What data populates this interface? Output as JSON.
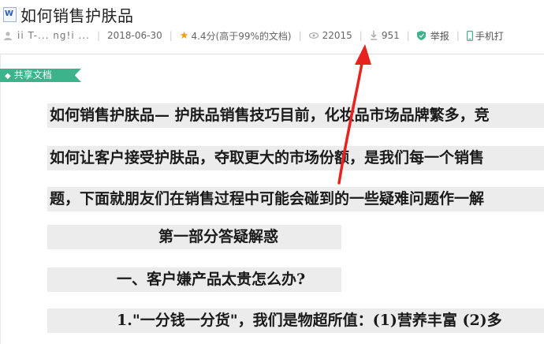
{
  "document": {
    "type_badge": "W",
    "title": "如何销售护肤品"
  },
  "meta": {
    "author": "ii T-... ng!i ...",
    "date": "2018-06-30",
    "rating": "4.4分(高于99%的文档)",
    "views": "22015",
    "downloads": "951",
    "report_label": "举报",
    "mobile_label": "手机打"
  },
  "share_tag": "共享文档",
  "body_lines": [
    "如何销售护肤品— 护肤品销售技巧目前，化妆品市场品牌繁多，竞",
    "如何让客户接受护肤品，夺取更大的市场份额，是我们每一个销售",
    "题，下面就朋友们在销售过程中可能会碰到的一些疑难问题作一解",
    "第一部分答疑解惑",
    "一、客户嫌产品太贵怎么办?",
    "1.\"一分钱一分货\"，我们是物超所值：(1)营养丰富 (2)多"
  ],
  "colors": {
    "tag_green": "#3cb38a",
    "arrow_red": "#e8231f",
    "star": "#f39c12"
  }
}
